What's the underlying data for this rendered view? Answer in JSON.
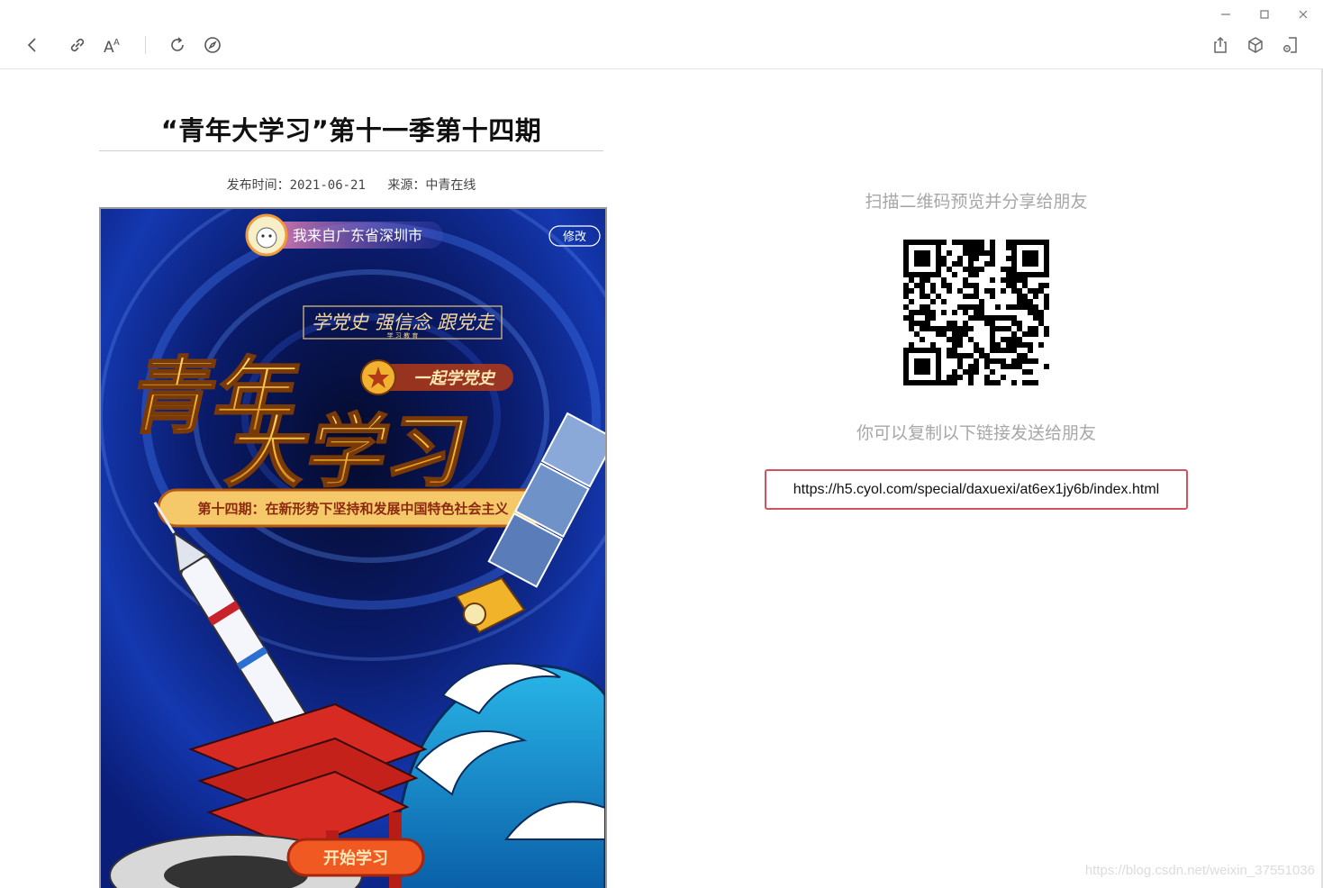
{
  "window": {
    "minimize_icon": "minimize-icon",
    "maximize_icon": "maximize-icon",
    "close_icon": "close-icon"
  },
  "toolbar": {
    "left_icons": [
      "back-icon",
      "link-icon",
      "font-size-icon",
      "refresh-icon",
      "compass-icon"
    ],
    "right_icons": [
      "share-icon",
      "cube-icon",
      "mini-program-icon"
    ]
  },
  "article": {
    "title": "“青年大学习”第十一季第十四期",
    "publish_label": "发布时间：2021-06-21",
    "source_label": "来源：中青在线"
  },
  "poster": {
    "location_text": "我来自广东省深圳市",
    "modify_button": "修改",
    "slogan": "学党史 强信念 跟党走",
    "slogan_sub": "学 习 教 育",
    "big_title_line1": "青年",
    "big_title_line2": "大学习",
    "badge": "一起学党史",
    "episode": "第十四期：在新形势下坚持和发展中国特色社会主义",
    "start_button": "开始学习"
  },
  "share": {
    "scan_text": "扫描二维码预览并分享给朋友",
    "copy_text": "你可以复制以下链接发送给朋友",
    "url": "https://h5.cyol.com/special/daxuexi/at6ex1jy6b/index.html"
  },
  "watermark": "https://blog.csdn.net/weixin_37551036",
  "colors": {
    "accent_border": "#d25260",
    "poster_blue": "#0b2a8c",
    "title_gold": "#f2b230",
    "muted_text": "#a7a7a7"
  }
}
